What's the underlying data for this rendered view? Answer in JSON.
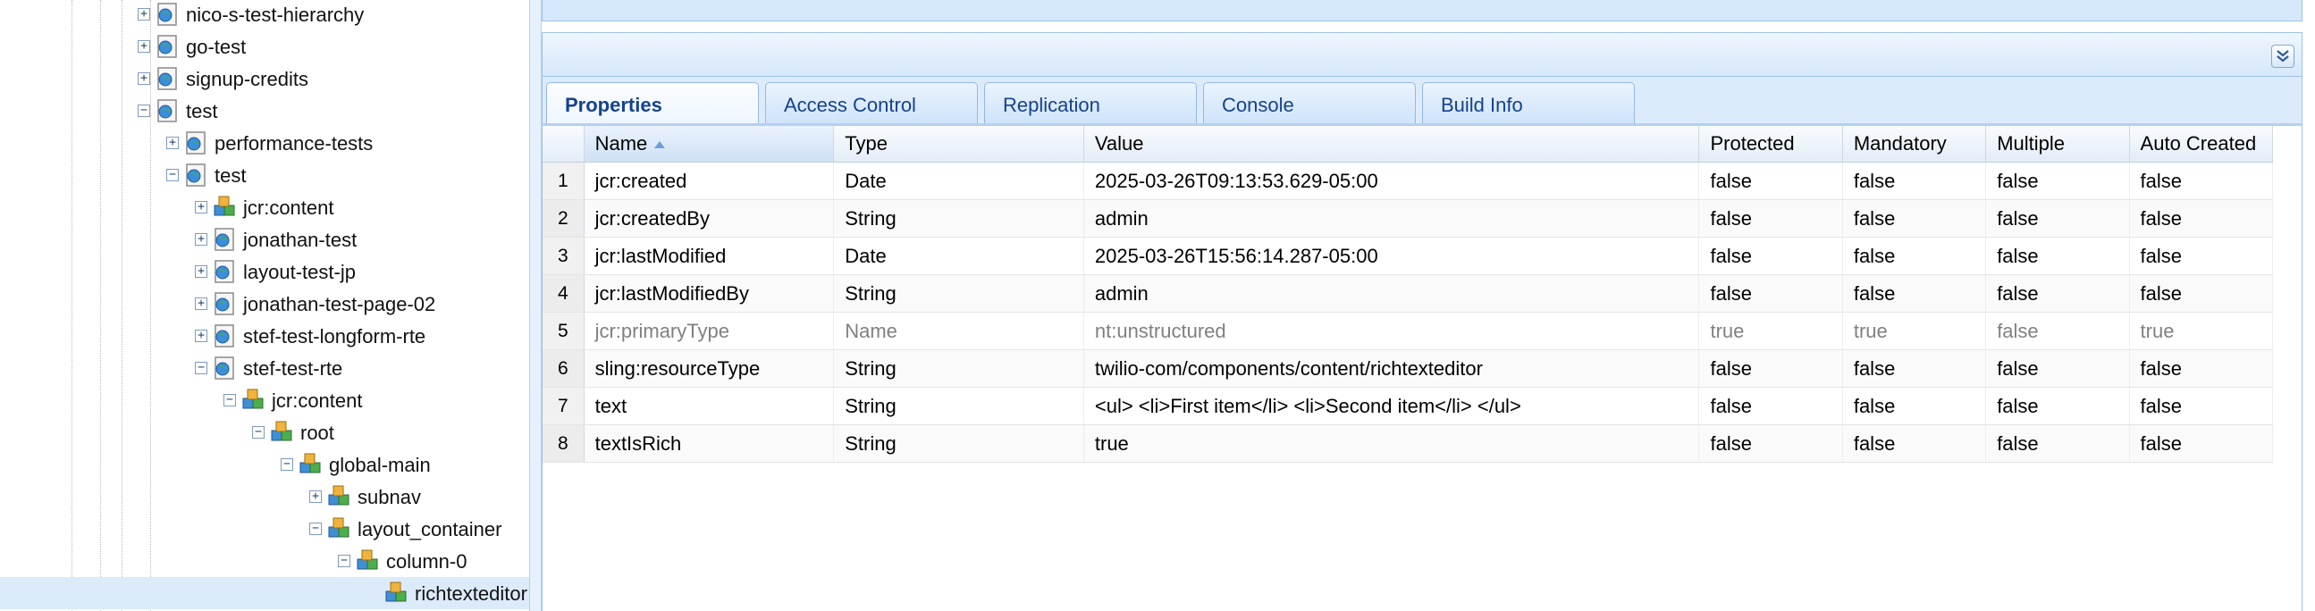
{
  "tree": {
    "nodes": [
      {
        "label": "nico-s-test-hierarchy",
        "depth": 0,
        "toggle": "+",
        "icon": "page-icon"
      },
      {
        "label": "go-test",
        "depth": 0,
        "toggle": "+",
        "icon": "page-icon"
      },
      {
        "label": "signup-credits",
        "depth": 0,
        "toggle": "+",
        "icon": "page-icon"
      },
      {
        "label": "test",
        "depth": 0,
        "toggle": "-",
        "icon": "page-icon"
      },
      {
        "label": "performance-tests",
        "depth": 1,
        "toggle": "+",
        "icon": "page-icon"
      },
      {
        "label": "test",
        "depth": 1,
        "toggle": "-",
        "icon": "page-icon"
      },
      {
        "label": "jcr:content",
        "depth": 2,
        "toggle": "+",
        "icon": "component-icon"
      },
      {
        "label": "jonathan-test",
        "depth": 2,
        "toggle": "+",
        "icon": "page-icon"
      },
      {
        "label": "layout-test-jp",
        "depth": 2,
        "toggle": "+",
        "icon": "page-icon"
      },
      {
        "label": "jonathan-test-page-02",
        "depth": 2,
        "toggle": "+",
        "icon": "page-icon"
      },
      {
        "label": "stef-test-longform-rte",
        "depth": 2,
        "toggle": "+",
        "icon": "page-icon"
      },
      {
        "label": "stef-test-rte",
        "depth": 2,
        "toggle": "-",
        "icon": "page-icon"
      },
      {
        "label": "jcr:content",
        "depth": 3,
        "toggle": "-",
        "icon": "component-icon"
      },
      {
        "label": "root",
        "depth": 4,
        "toggle": "-",
        "icon": "component-icon"
      },
      {
        "label": "global-main",
        "depth": 5,
        "toggle": "-",
        "icon": "component-icon"
      },
      {
        "label": "subnav",
        "depth": 6,
        "toggle": "+",
        "icon": "component-icon"
      },
      {
        "label": "layout_container",
        "depth": 6,
        "toggle": "-",
        "icon": "component-icon"
      },
      {
        "label": "column-0",
        "depth": 7,
        "toggle": "-",
        "icon": "component-icon"
      },
      {
        "label": "richtexteditor",
        "depth": 8,
        "toggle": "",
        "icon": "component-icon",
        "selected": true
      }
    ]
  },
  "tabs": [
    {
      "label": "Properties",
      "active": true
    },
    {
      "label": "Access Control",
      "active": false
    },
    {
      "label": "Replication",
      "active": false
    },
    {
      "label": "Console",
      "active": false
    },
    {
      "label": "Build Info",
      "active": false
    }
  ],
  "grid": {
    "columns": [
      "Name",
      "Type",
      "Value",
      "Protected",
      "Mandatory",
      "Multiple",
      "Auto Created"
    ],
    "sorted_column": "Name",
    "rows": [
      {
        "num": "1",
        "cells": [
          "jcr:created",
          "Date",
          "2025-03-26T09:13:53.629-05:00",
          "false",
          "false",
          "false",
          "false"
        ]
      },
      {
        "num": "2",
        "cells": [
          "jcr:createdBy",
          "String",
          "admin",
          "false",
          "false",
          "false",
          "false"
        ]
      },
      {
        "num": "3",
        "cells": [
          "jcr:lastModified",
          "Date",
          "2025-03-26T15:56:14.287-05:00",
          "false",
          "false",
          "false",
          "false"
        ]
      },
      {
        "num": "4",
        "cells": [
          "jcr:lastModifiedBy",
          "String",
          "admin",
          "false",
          "false",
          "false",
          "false"
        ]
      },
      {
        "num": "5",
        "muted": true,
        "cells": [
          "jcr:primaryType",
          "Name",
          "nt:unstructured",
          "true",
          "true",
          "false",
          "true"
        ]
      },
      {
        "num": "6",
        "cells": [
          "sling:resourceType",
          "String",
          "twilio-com/components/content/richtexteditor",
          "false",
          "false",
          "false",
          "false"
        ]
      },
      {
        "num": "7",
        "cells": [
          "text",
          "String",
          "<ul> <li>First item</li> <li>Second item</li> </ul>",
          "false",
          "false",
          "false",
          "false"
        ]
      },
      {
        "num": "8",
        "cells": [
          "textIsRich",
          "String",
          "true",
          "false",
          "false",
          "false",
          "false"
        ]
      }
    ]
  },
  "colors": {
    "accent": "#15428b",
    "panel": "#d6e8fb",
    "border": "#9ec2eb",
    "selection": "#dcebfa"
  }
}
